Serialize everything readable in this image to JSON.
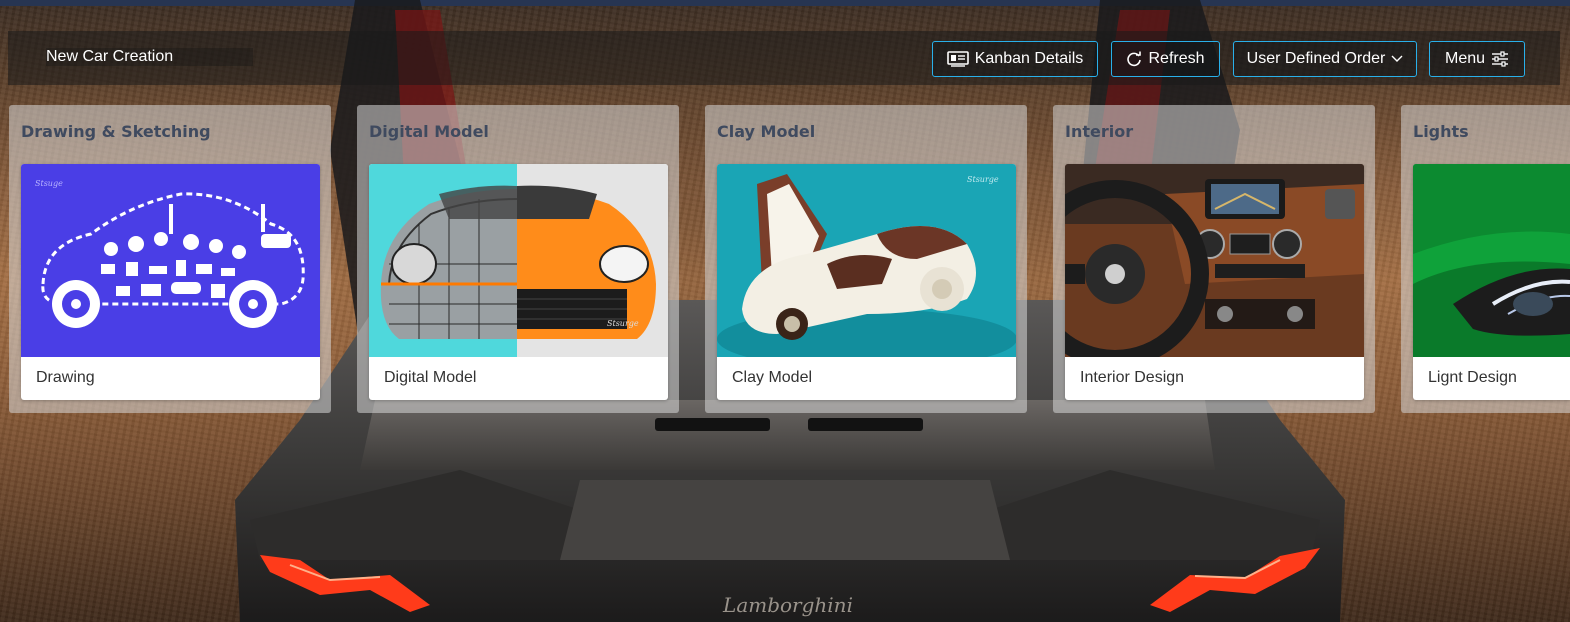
{
  "header": {
    "title": "New Car Creation",
    "buttons": {
      "kanban_details": "Kanban Details",
      "refresh": "Refresh",
      "order": "User Defined Order",
      "menu": "Menu"
    }
  },
  "columns": [
    {
      "title": "Drawing & Sketching",
      "card_label": "Drawing",
      "image": "car-icons-illustration"
    },
    {
      "title": "Digital Model",
      "card_label": "Digital Model",
      "image": "digital-car-render"
    },
    {
      "title": "Clay Model",
      "card_label": "Clay Model",
      "image": "clay-car-model"
    },
    {
      "title": "Interior",
      "card_label": "Interior Design",
      "image": "car-interior-dashboard"
    },
    {
      "title": "Lights",
      "card_label": "Lignt Design",
      "image": "car-headlight"
    }
  ],
  "background": {
    "brand_text": "Lamborghini"
  },
  "colors": {
    "accent": "#29b0ea",
    "column_title": "#3f4a5f"
  }
}
